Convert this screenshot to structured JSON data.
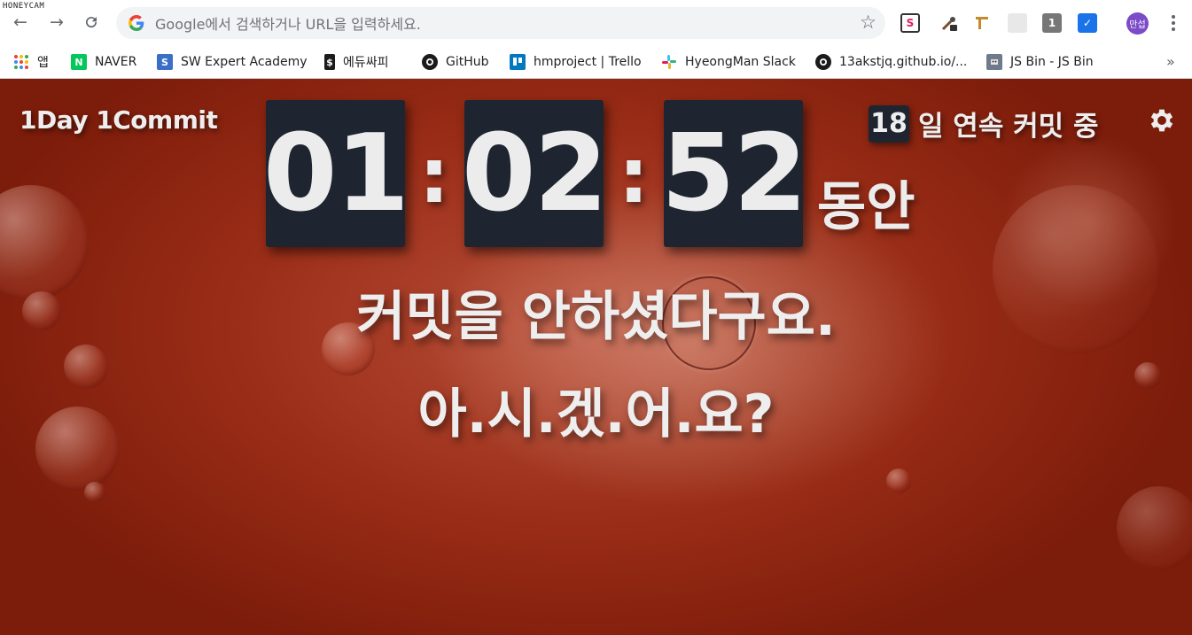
{
  "watermark": "HONEYCAM",
  "browser": {
    "omnibox_placeholder": "Google에서 검색하거나 URL을 입력하세요.",
    "profile_initials": "만섭",
    "extension_badge": "1",
    "bookmarks": [
      {
        "label": "앱",
        "icon": "apps-grid-icon"
      },
      {
        "label": "NAVER",
        "icon": "naver-icon",
        "glyph": "N",
        "color": "#03c75a"
      },
      {
        "label": "SW Expert Academy",
        "icon": "swea-icon",
        "glyph": "S",
        "color": "#3b6fc7"
      },
      {
        "label": "에듀싸피",
        "icon": "edussafy-icon",
        "glyph": "$",
        "color": "#1b1b1b"
      },
      {
        "label": "GitHub",
        "icon": "github-icon"
      },
      {
        "label": "hmproject | Trello",
        "icon": "trello-icon",
        "color": "#0079bf"
      },
      {
        "label": "HyeongMan Slack",
        "icon": "slack-icon"
      },
      {
        "label": "13akstjq.github.io/...",
        "icon": "github-icon"
      },
      {
        "label": "JS Bin - JS Bin",
        "icon": "jsbin-icon"
      }
    ],
    "more_label": "»"
  },
  "page": {
    "brand": "1Day 1Commit",
    "streak_count": "18",
    "streak_label": "일 연속 커밋 중",
    "timer": {
      "hours": "01",
      "minutes": "02",
      "seconds": "52",
      "separator": ":"
    },
    "timer_suffix": "동안",
    "message_line1": "커밋을 안하셨다구요.",
    "message_line2": "아.시.겠.어.요?"
  },
  "colors": {
    "background": "#9a2d17",
    "digit_box": "#1e2530",
    "text": "#eeeeee"
  }
}
